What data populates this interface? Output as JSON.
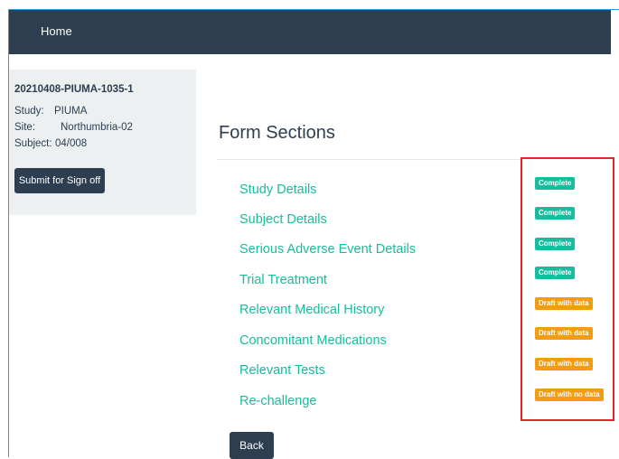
{
  "navbar": {
    "home_label": "Home"
  },
  "sidebar": {
    "case_id": "20210408-PIUMA-1035-1",
    "study_key": "Study:",
    "study_value": "PIUMA",
    "site_key": "Site:",
    "site_value": "Northumbria-02",
    "subject_key": "Subject:",
    "subject_value": "04/008",
    "signoff_label": "Submit for Sign off"
  },
  "main": {
    "title": "Form Sections",
    "sections": [
      {
        "label": "Study Details",
        "status": "Complete"
      },
      {
        "label": "Subject Details",
        "status": "Complete"
      },
      {
        "label": "Serious Adverse Event Details",
        "status": "Complete"
      },
      {
        "label": "Trial Treatment",
        "status": "Complete"
      },
      {
        "label": "Relevant Medical History",
        "status": "Draft with data"
      },
      {
        "label": "Concomitant Medications",
        "status": "Draft with data"
      },
      {
        "label": "Relevant Tests",
        "status": "Draft with data"
      },
      {
        "label": "Re-challenge",
        "status": "Draft with no data"
      }
    ],
    "back_label": "Back"
  },
  "colors": {
    "navbar": "#2c3e50",
    "link": "#18bc9c",
    "badge_complete": "#18bc9c",
    "badge_draft": "#f39c12",
    "highlight": "#e1262c"
  }
}
